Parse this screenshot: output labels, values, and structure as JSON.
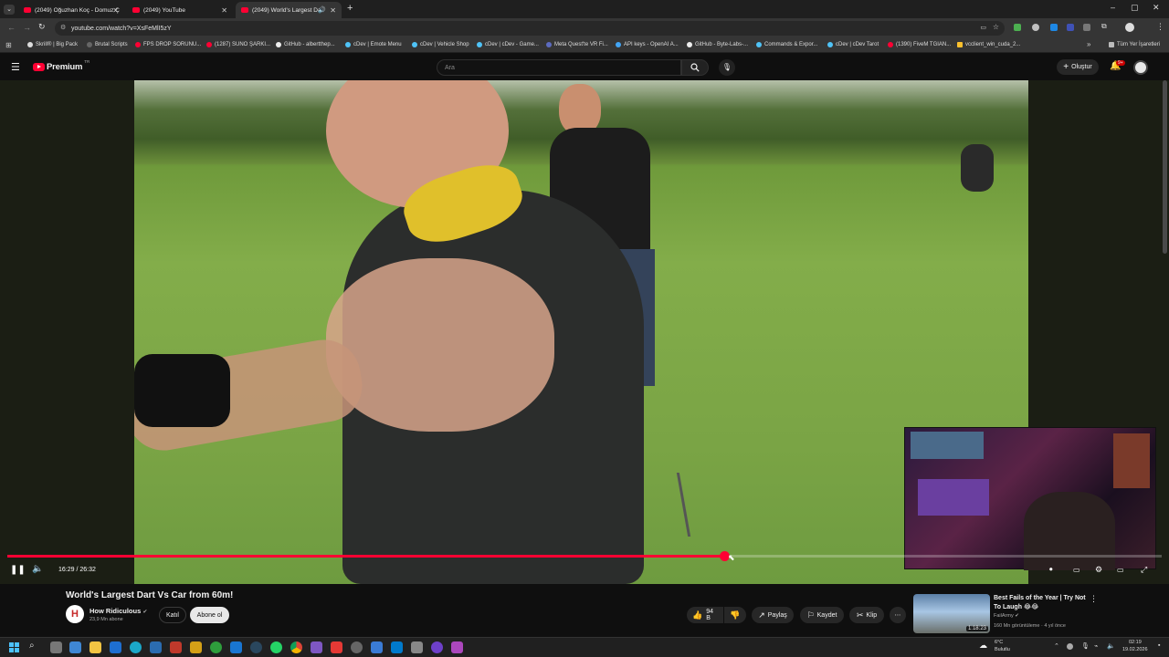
{
  "browser": {
    "tabs": [
      {
        "title": "(2049) Oğuzhan Koç - Domuz Ç"
      },
      {
        "title": "(2049) YouTube"
      },
      {
        "title": "(2049) World's Largest Dart"
      }
    ],
    "url": "youtube.com/watch?v=XsFeMlI5zY",
    "bookmarks": [
      "Skrill® | Big Pack",
      "Brutal Scripts",
      "FPS DROP SORUNU...",
      "(1287) SUNO ŞARKI...",
      "GitHub - albertthep...",
      "cDev | Emote Menu",
      "cDev | Vehicle Shop",
      "cDev | cDev - Game...",
      "Meta Quest'te VR Fi...",
      "API keys - OpenAI A...",
      "GitHub - Byte-Labs-...",
      "Commands & Expor...",
      "cDev | cDev Tarot",
      "(1390) FiveM TGIAN...",
      "vcclient_win_cuda_2..."
    ],
    "all_bookmarks": "Tüm Yer İşaretleri"
  },
  "youtube": {
    "logo_text": "Premium",
    "logo_badge": "TR",
    "search_placeholder": "Ara",
    "create_label": "Oluştur",
    "notif_count": "9+"
  },
  "player": {
    "time": "16:29 / 26:32",
    "progress": 0.621
  },
  "video": {
    "title": "World's Largest Dart Vs Car from 60m!",
    "channel": "How Ridiculous",
    "subscribers": "23,9 Mn abone",
    "join_label": "Katıl",
    "subscribe_label": "Abone ol",
    "likes": "94 B",
    "share_label": "Paylaş",
    "save_label": "Kaydet",
    "clip_label": "Klip"
  },
  "recommended": {
    "title": "Best Fails of the Year | Try Not To Laugh 😂😂",
    "channel": "FailArmy",
    "meta": "160 Mn görüntüleme · 4 yıl önce",
    "duration": "1:18:23"
  },
  "taskbar": {
    "weather_temp": "6°C",
    "weather_desc": "Bulutlu",
    "clock_time": "02:19",
    "clock_date": "19.02.2026"
  },
  "colors": {
    "progress_red": "#ff0033",
    "bg": "#0f0f0f"
  }
}
